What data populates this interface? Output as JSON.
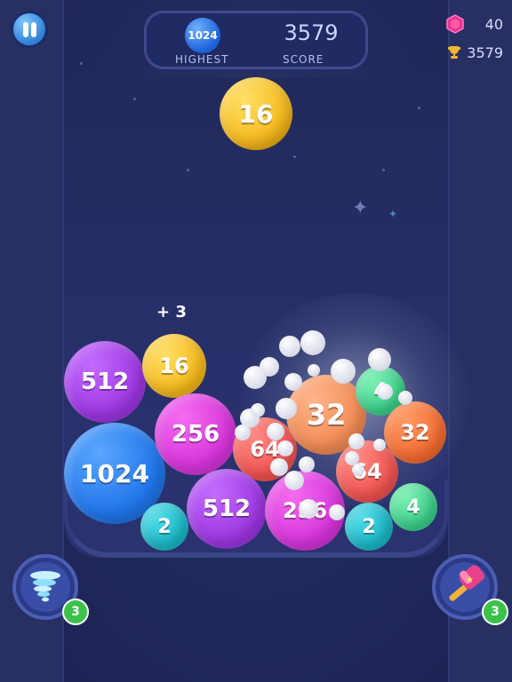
{
  "hud": {
    "highest_value": "1024",
    "highest_label": "HIGHEST",
    "score_value": "3579",
    "score_label": "SCORE",
    "gems": "40",
    "trophy": "3579"
  },
  "next_ball": "16",
  "combo_text": "+ 3",
  "balls": [
    "512",
    "16",
    "1024",
    "256",
    "64",
    "32",
    "4",
    "32",
    "64",
    "2",
    "512",
    "256",
    "2",
    "4"
  ],
  "powerups": {
    "tornado_count": "3",
    "hammer_count": "3"
  },
  "colors": {
    "purple": "#9b35e0",
    "yellow": "#f5b81a",
    "blue": "#1f74e8",
    "magenta": "#d533d9",
    "red": "#f0524f",
    "orange": "#f08a54",
    "green": "#3bd08a",
    "orange_red": "#f36a2f",
    "teal": "#1ab9c8"
  }
}
